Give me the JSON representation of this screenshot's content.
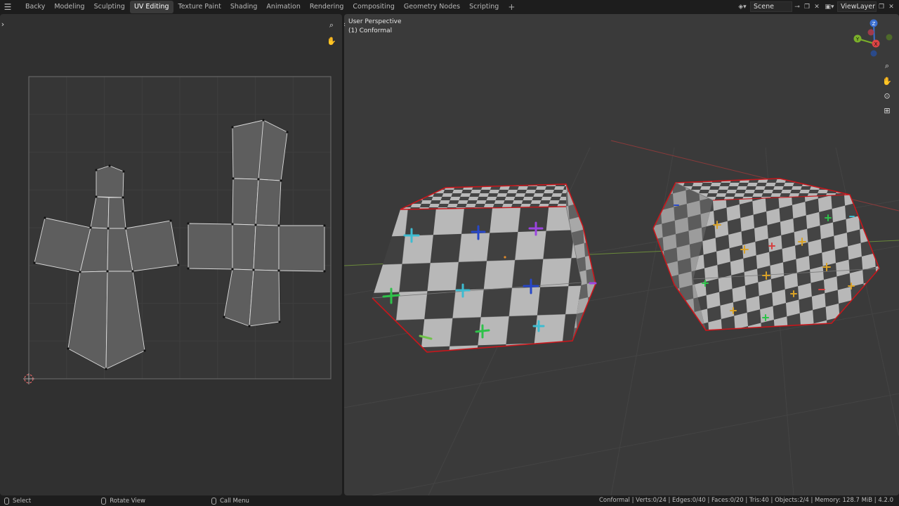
{
  "menu_icon": "hamburger-icon",
  "workspaces": [
    "Backy",
    "Modeling",
    "Sculpting",
    "UV Editing",
    "Texture Paint",
    "Shading",
    "Animation",
    "Rendering",
    "Compositing",
    "Geometry Nodes",
    "Scripting"
  ],
  "active_workspace": "UV Editing",
  "add_workspace": "+",
  "scene": {
    "label": "Scene",
    "icon": "scene-icon"
  },
  "view_layer": {
    "label": "ViewLayer",
    "icon": "view-layer-icon"
  },
  "viewport": {
    "line1": "User Perspective",
    "line2": "(1) Conformal",
    "gizmo": {
      "z": "Z",
      "y": "Y",
      "x": "X"
    }
  },
  "statusbar": {
    "select": "Select",
    "rotate": "Rotate View",
    "menu": "Call Menu",
    "stats": "Conformal | Verts:0/24 | Edges:0/40 | Faces:0/20 | Tris:40 | Objects:2/4 | Memory: 128.7 MiB | 4.2.0"
  },
  "colors": {
    "accent_selected_edges": "#c8161b",
    "active_tab": "#3a3a3a",
    "uv_face": "#5a5a5a",
    "checker_light": "#b8b8b8",
    "checker_dark": "#404040"
  }
}
